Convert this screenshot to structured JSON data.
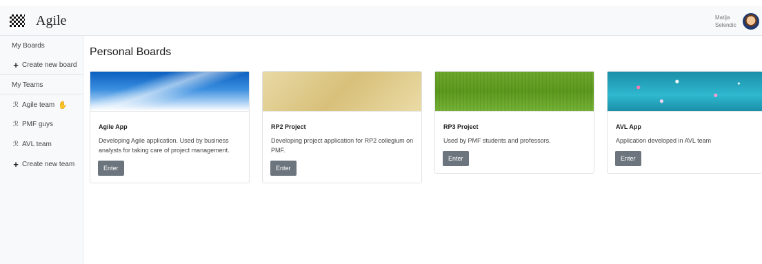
{
  "header": {
    "app_title": "Agile",
    "user_first": "Matija",
    "user_last": "Selendic",
    "logo_icon": "checkerboard-logo",
    "avatar_icon": "user-avatar"
  },
  "sidebar": {
    "my_boards": "My Boards",
    "create_board": "Create new board",
    "my_teams": "My Teams",
    "teams": [
      {
        "label": "Agile team",
        "icon": "team-icon",
        "badge_icon": "hand-icon"
      },
      {
        "label": "PMF guys",
        "icon": "team-icon"
      },
      {
        "label": "AVL team",
        "icon": "team-icon"
      }
    ],
    "create_team": "Create new team",
    "plus_glyph": "+",
    "team_glyph": "ℛ",
    "hand_glyph": "✋"
  },
  "main": {
    "title": "Personal Boards",
    "enter_label": "Enter",
    "cards": [
      {
        "title": "Agile App",
        "description": "Developing Agile application. Used by business analysts for taking care of project management."
      },
      {
        "title": "RP2 Project",
        "description": "Developing project application for RP2 collegium on PMF."
      },
      {
        "title": "RP3 Project",
        "description": "Used by PMF students and professors."
      },
      {
        "title": "AVL App",
        "description": "Application developed in AVL team"
      }
    ]
  },
  "colors": {
    "button": "#6c757d",
    "sidebar_bg": "#f8f9fa",
    "hand_accent": "#1b2fd6"
  }
}
